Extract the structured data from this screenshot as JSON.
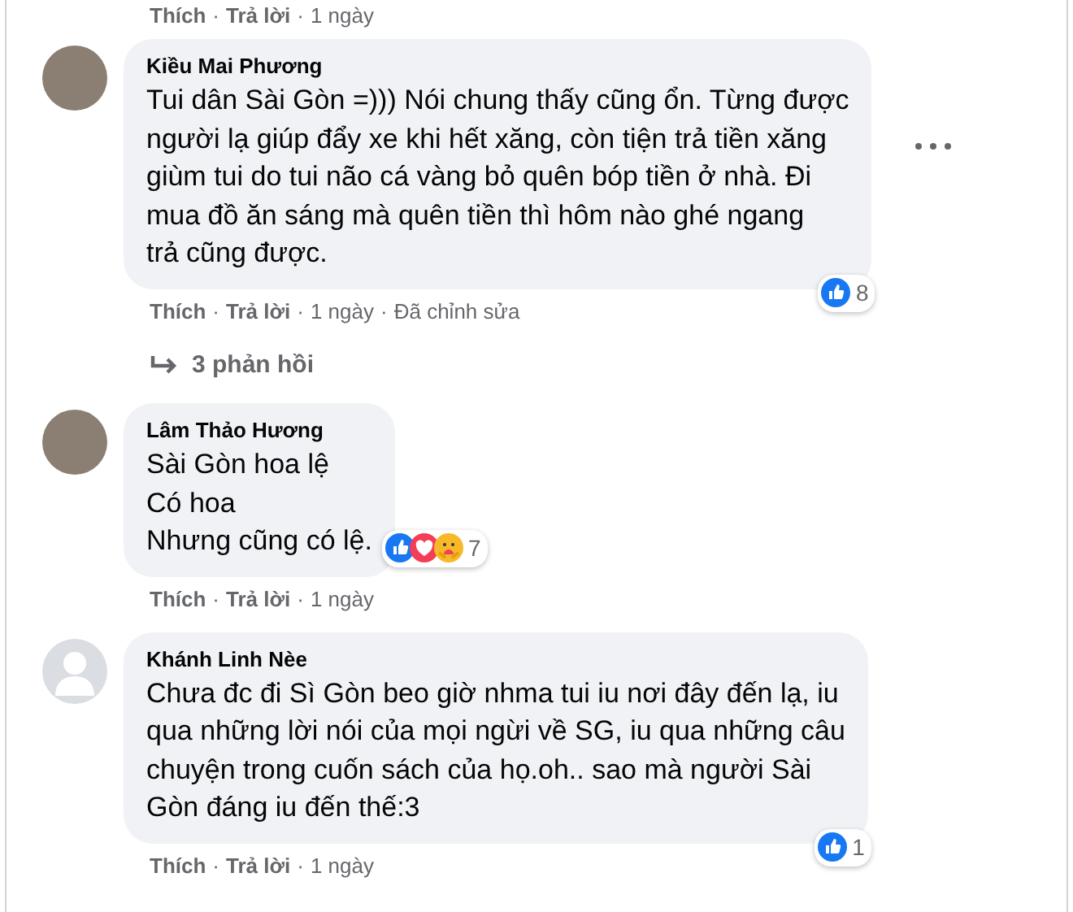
{
  "separator": "·",
  "top_footer": [
    {
      "kind": "action",
      "text": "Thích"
    },
    {
      "kind": "action",
      "text": "Trả lời"
    },
    {
      "kind": "meta",
      "text": "1 ngày"
    }
  ],
  "comments": [
    {
      "avatar": {
        "kind": "photo"
      },
      "author": "Kiều Mai Phương",
      "text": "Tui dân Sài Gòn =))) Nói chung thấy cũng ổn. Từng được\nngười lạ giúp đẩy xe khi hết xăng, còn tiện trả tiền xăng\ngiùm tui do tui não cá vàng bỏ quên bóp tiền ở nhà. Đi\nmua đồ ăn sáng mà quên tiền thì hôm nào ghé ngang\ntrả cũng được.",
      "more": true,
      "reactions": [
        {
          "kind": "like"
        }
      ],
      "reaction_count": "8",
      "footer": [
        {
          "kind": "action",
          "text": "Thích"
        },
        {
          "kind": "action",
          "text": "Trả lời"
        },
        {
          "kind": "meta",
          "text": "1 ngày"
        },
        {
          "kind": "meta",
          "text": "Đã chỉnh sửa"
        }
      ],
      "replies": "3 phản hồi"
    },
    {
      "avatar": {
        "kind": "photo"
      },
      "author": "Lâm Thảo Hương",
      "text": "Sài Gòn hoa lệ\nCó hoa\nNhưng cũng có lệ.",
      "more": false,
      "reactions": [
        {
          "kind": "like"
        },
        {
          "kind": "love"
        },
        {
          "kind": "care"
        }
      ],
      "reaction_count": "7",
      "footer": [
        {
          "kind": "action",
          "text": "Thích"
        },
        {
          "kind": "action",
          "text": "Trả lời"
        },
        {
          "kind": "meta",
          "text": "1 ngày"
        }
      ]
    },
    {
      "avatar": {
        "kind": "default"
      },
      "author": "Khánh Linh Nèe",
      "text": "Chưa đc đi Sì Gòn beo giờ nhma tui iu nơi đây đến lạ, iu\nqua những lời nói của mọi ngừi về SG, iu qua những câu\nchuyện trong cuốn sách của họ.oh.. sao mà người Sài\nGòn đáng iu đến thế:3",
      "more": false,
      "reactions": [
        {
          "kind": "like"
        }
      ],
      "reaction_count": "1",
      "footer": [
        {
          "kind": "action",
          "text": "Thích"
        },
        {
          "kind": "action",
          "text": "Trả lời"
        },
        {
          "kind": "meta",
          "text": "1 ngày"
        }
      ]
    }
  ]
}
